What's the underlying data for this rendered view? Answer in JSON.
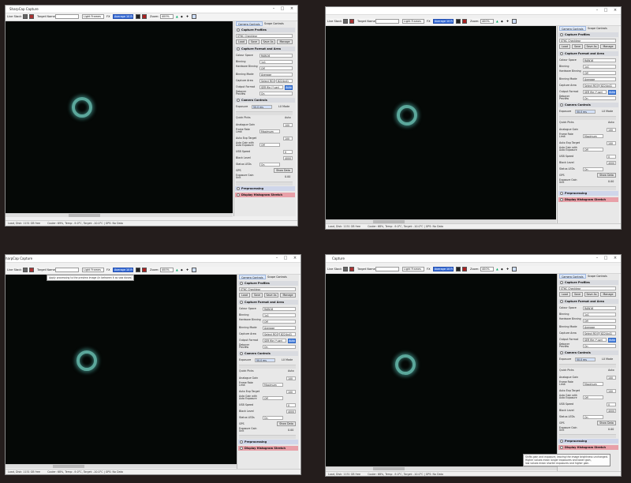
{
  "app": {
    "title": "SharpCap Capture",
    "title_partial": "harpCap Capture",
    "title_short": "Capture"
  },
  "toolbar": {
    "live_stack": "Live Stack",
    "target_name": "Target Name:",
    "frame_mode": "Light Frames",
    "fx": "FX",
    "average": "Average 10 Frames",
    "zoom_label": "Zoom:",
    "zoom_value": "400%",
    "zoom_value_alt": "400%"
  },
  "panel": {
    "tabs": [
      "Camera Controls",
      "Scope Controls"
    ],
    "sections": {
      "capture_profiles": "Capture Profiles",
      "capture_format": "Capture Format and Area",
      "camera_controls": "Camera Controls",
      "preprocessing": "Preprocessing",
      "display_histogram": "Display Histogram Stretch"
    },
    "profile": "ST6C Checklear",
    "profile_buttons": [
      "Load",
      "Save",
      "Save As",
      "Manage"
    ],
    "rows": {
      "colour_space": {
        "label": "Colour Space",
        "value": "RAW16"
      },
      "binning": {
        "label": "Binning",
        "value": "1x1"
      },
      "hardware_binning": {
        "label": "Hardware Binning",
        "value": "Off"
      },
      "binning_mode": {
        "label": "Binning Mode",
        "value": "Average"
      },
      "capture_area": {
        "label": "Capture Area",
        "value": "Select ROI",
        "value2": "8224x41"
      },
      "output_format": {
        "label": "Output Format",
        "value": "SER file (*.ser)",
        "button": "Auto"
      },
      "debayer_preview": {
        "label": "Debayer Preview",
        "value": "On"
      },
      "exposure": {
        "label": "Exposure",
        "value": "50.0 ms",
        "check": "LX Mode"
      },
      "quick_picks": {
        "label": "Quick Picks",
        "check": "Auto"
      },
      "analogue_gain": {
        "label": "Analogue Gain",
        "value": "100"
      },
      "frame_rate_limit": {
        "label": "Frame Rate Limit",
        "value": "Maximum"
      },
      "auto_exp_target": {
        "label": "Auto Exp Target",
        "value": "100"
      },
      "auto_gain": {
        "label": "Auto Gain with Auto Exposure",
        "value": "Off"
      },
      "usb_speed": {
        "label": "USB Speed",
        "value": "0"
      },
      "black_level": {
        "label": "Black Level",
        "value": "4000"
      },
      "status_leds": {
        "label": "Status LEDs",
        "value": "On"
      },
      "gps": {
        "label": "GPS",
        "button": "Show Data"
      },
      "exposure_gain_unit": {
        "label": "Exposure Gain Unit",
        "value": "0.00"
      }
    }
  },
  "status": {
    "text": "Load, Disk: 1151 GB free",
    "text_alt": "Load, Disk: 1151 GB free",
    "camera": "Cooler: 69%, Temp: -9.0°C, Target: -10.0°C | GPS: No Data",
    "camera_alt": "Cooler: 68%, Temp: -9.0°C, Target: -10.0°C | GPS: No Data"
  },
  "tooltip_tl": "Apply processing to the preview image (in between it as saw doses)",
  "tooltip_br": [
    "Shifts gain and exposure, leaving the image brightness unchanged.",
    "Higher values mean longer exposures and lower gain,",
    "low values mean shorter exposures and higher gain."
  ],
  "colors": {
    "desktop": "#241d1c",
    "preview": "#050806",
    "star": "#78dccd",
    "section_pink": "#e8a0a8",
    "highlight": "#3a6fd8"
  },
  "icons": [
    "gear-icon",
    "histogram-icon",
    "zoom-in-icon",
    "zoom-out-icon",
    "close-icon",
    "maximize-icon",
    "minimize-icon"
  ]
}
